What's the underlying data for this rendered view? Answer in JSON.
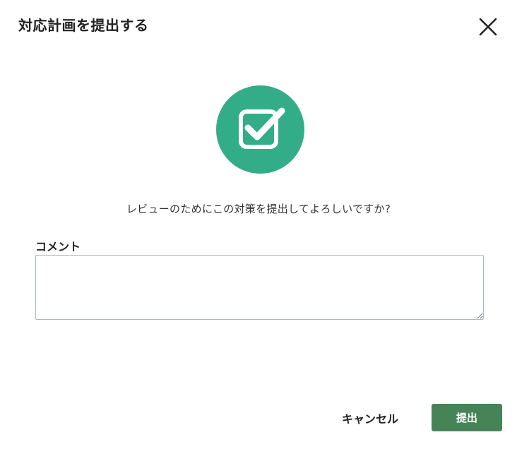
{
  "dialog": {
    "title": "対応計画を提出する",
    "close_icon": "close-icon",
    "hero_icon": "checkbox-check-icon",
    "accent_color": "#32ad87",
    "prompt": "レビューのためにこの対策を提出してよろしいですか?"
  },
  "comment": {
    "label": "コメント",
    "value": "",
    "placeholder": ""
  },
  "actions": {
    "cancel_label": "キャンセル",
    "submit_label": "提出",
    "submit_color": "#468458"
  }
}
